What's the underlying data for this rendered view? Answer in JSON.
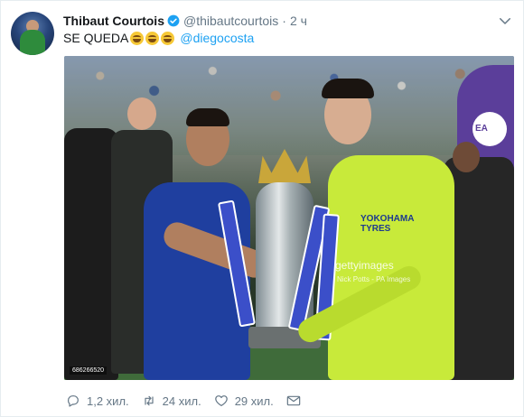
{
  "tweet": {
    "author": {
      "display_name": "Thibaut Courtois",
      "handle": "@thibautcourtois",
      "separator": "·",
      "time": "2 ч",
      "verified": true
    },
    "text": "SE QUEDA",
    "emoji": [
      "face-with-tears-of-joy",
      "face-with-tears-of-joy",
      "face-with-tears-of-joy"
    ],
    "mention": "@diegocosta",
    "photo": {
      "watermark": "gettyimages",
      "watermark_credit": "Nick Potts - PA Images",
      "photo_id": "686266520",
      "shirt_text": "YOKOHAMA\nTYRES",
      "banner_text": "EA"
    },
    "actions": {
      "reply_count": "1,2 хил.",
      "retweet_count": "24 хил.",
      "like_count": "29 хил."
    },
    "icons": [
      "verified-badge-icon",
      "chevron-down-icon",
      "reply-icon",
      "retweet-icon",
      "heart-icon",
      "mail-icon"
    ],
    "colors": {
      "accent": "#1da1f2",
      "muted": "#657786",
      "text": "#14171a"
    }
  }
}
